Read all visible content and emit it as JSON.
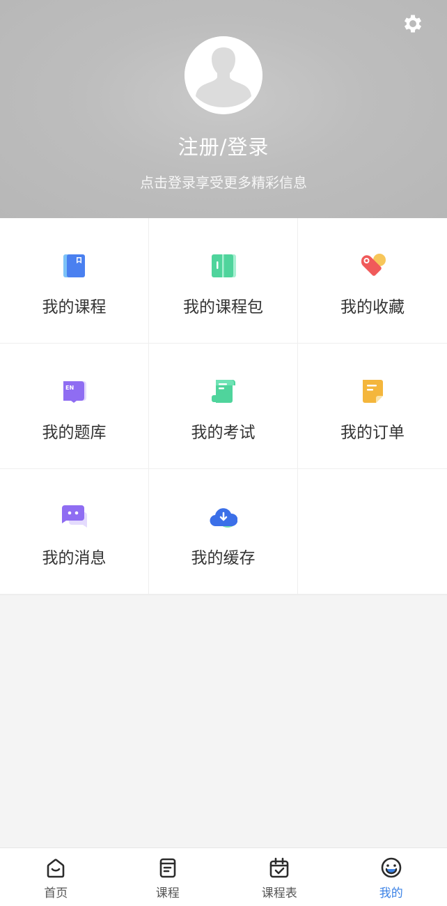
{
  "header": {
    "title": "注册/登录",
    "subtitle": "点击登录享受更多精彩信息",
    "settings_icon": "gear-icon",
    "avatar_icon": "default-avatar-icon"
  },
  "menu": [
    {
      "label": "我的课程",
      "icon": "course-book-icon",
      "color": "#4a80f0"
    },
    {
      "label": "我的课程包",
      "icon": "course-package-icon",
      "color": "#4fd49c"
    },
    {
      "label": "我的收藏",
      "icon": "favorite-tag-icon",
      "color": "#f05a5a"
    },
    {
      "label": "我的题库",
      "icon": "question-bank-icon",
      "color": "#8f6df2"
    },
    {
      "label": "我的考试",
      "icon": "exam-scroll-icon",
      "color": "#4fd49c"
    },
    {
      "label": "我的订单",
      "icon": "order-note-icon",
      "color": "#f4b63c"
    },
    {
      "label": "我的消息",
      "icon": "message-bubble-icon",
      "color": "#8f6df2"
    },
    {
      "label": "我的缓存",
      "icon": "cloud-download-icon",
      "color": "#3b6fe8"
    }
  ],
  "tabbar": {
    "active": "我的",
    "active_color": "#3b82e6",
    "items": [
      {
        "label": "首页",
        "icon": "home-icon"
      },
      {
        "label": "课程",
        "icon": "course-list-icon"
      },
      {
        "label": "课程表",
        "icon": "calendar-check-icon"
      },
      {
        "label": "我的",
        "icon": "smiley-profile-icon"
      }
    ]
  }
}
